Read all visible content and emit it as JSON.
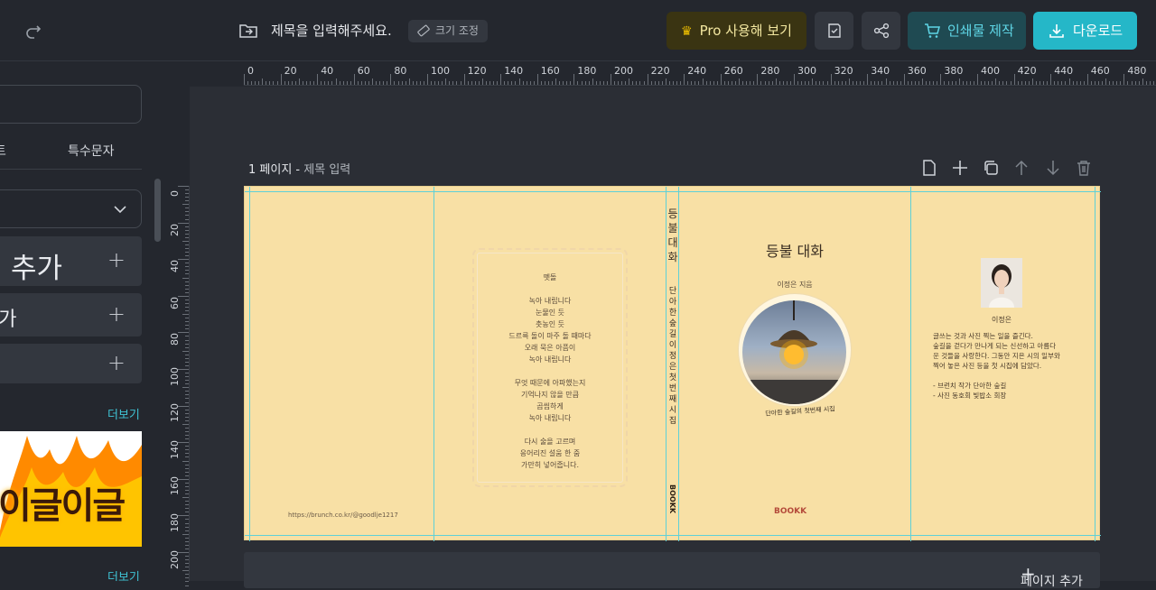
{
  "topbar": {
    "doc_title": "제목을 입력해주세요.",
    "resize_label": "크기 조정",
    "pro_label": "Pro 사용해 보기",
    "print_label": "인쇄물 제작",
    "download_label": "다운로드",
    "pro_color": "#f2c200",
    "download_color": "#25b7c8"
  },
  "sidebar": {
    "tab_partial": "트",
    "tab_special": "특수문자",
    "add_large": "추가",
    "add_medium": "추가",
    "more_label_1": "더보기",
    "more_label_2": "더보기",
    "banner_text": "이글이글"
  },
  "ruler": {
    "top": [
      "0",
      "20",
      "40",
      "60",
      "80",
      "100",
      "120",
      "140",
      "160",
      "180",
      "200",
      "220",
      "240",
      "260",
      "280",
      "300",
      "320",
      "340",
      "360",
      "380",
      "400",
      "420",
      "440",
      "460",
      "480"
    ],
    "left": [
      "0",
      "20",
      "40",
      "60",
      "80",
      "100",
      "120",
      "140",
      "160",
      "180",
      "200"
    ]
  },
  "page": {
    "number_label": "1 페이지",
    "separator": " - ",
    "title_placeholder": "제목 입력",
    "add_page_label": "페이지 추가"
  },
  "book": {
    "poem_lines": [
      "뗏돌",
      "",
      "녹아 내립니다",
      "눈물인 듯",
      "촛농인 듯",
      "드르륵 돌이 마주 돌 때마다",
      "오래 묵은 아픔이",
      "녹아 내립니다",
      "",
      "무엇 때문에 아파했는지",
      "기억나지 않을 만큼",
      "곱씹하게",
      "녹아 내립니다",
      "",
      "다시 술을 고르며",
      "응어리진 설움 한 줌",
      "가만히 넣어줍니다."
    ],
    "url": "https://brunch.co.kr/@goodlje1217",
    "spine_title": "등불대화",
    "spine_subtitle": "단아한숲길 이정은 첫번째시집",
    "spine_logo": "BOOKK",
    "cover_title": "등불 대화",
    "cover_author": "이정은 지음",
    "cover_caption": "단아한 숲길의 첫번째 시집",
    "cover_logo": "BOOKK",
    "author_name": "이정은",
    "bio_lines": [
      "글쓰는 것과 사진 찍는 일을 즐긴다.",
      "숲길을 걷다가 만나게 되는 신선하고 아름다",
      "운 것들을 사랑한다. 그동안 지은 시의 일부와",
      "찍어 놓은 사진 등을 첫 시집에 담았다.",
      "",
      "- 브런치 작가 단아한 숲길",
      "- 사진 동호회 빛밥소 회장"
    ]
  }
}
